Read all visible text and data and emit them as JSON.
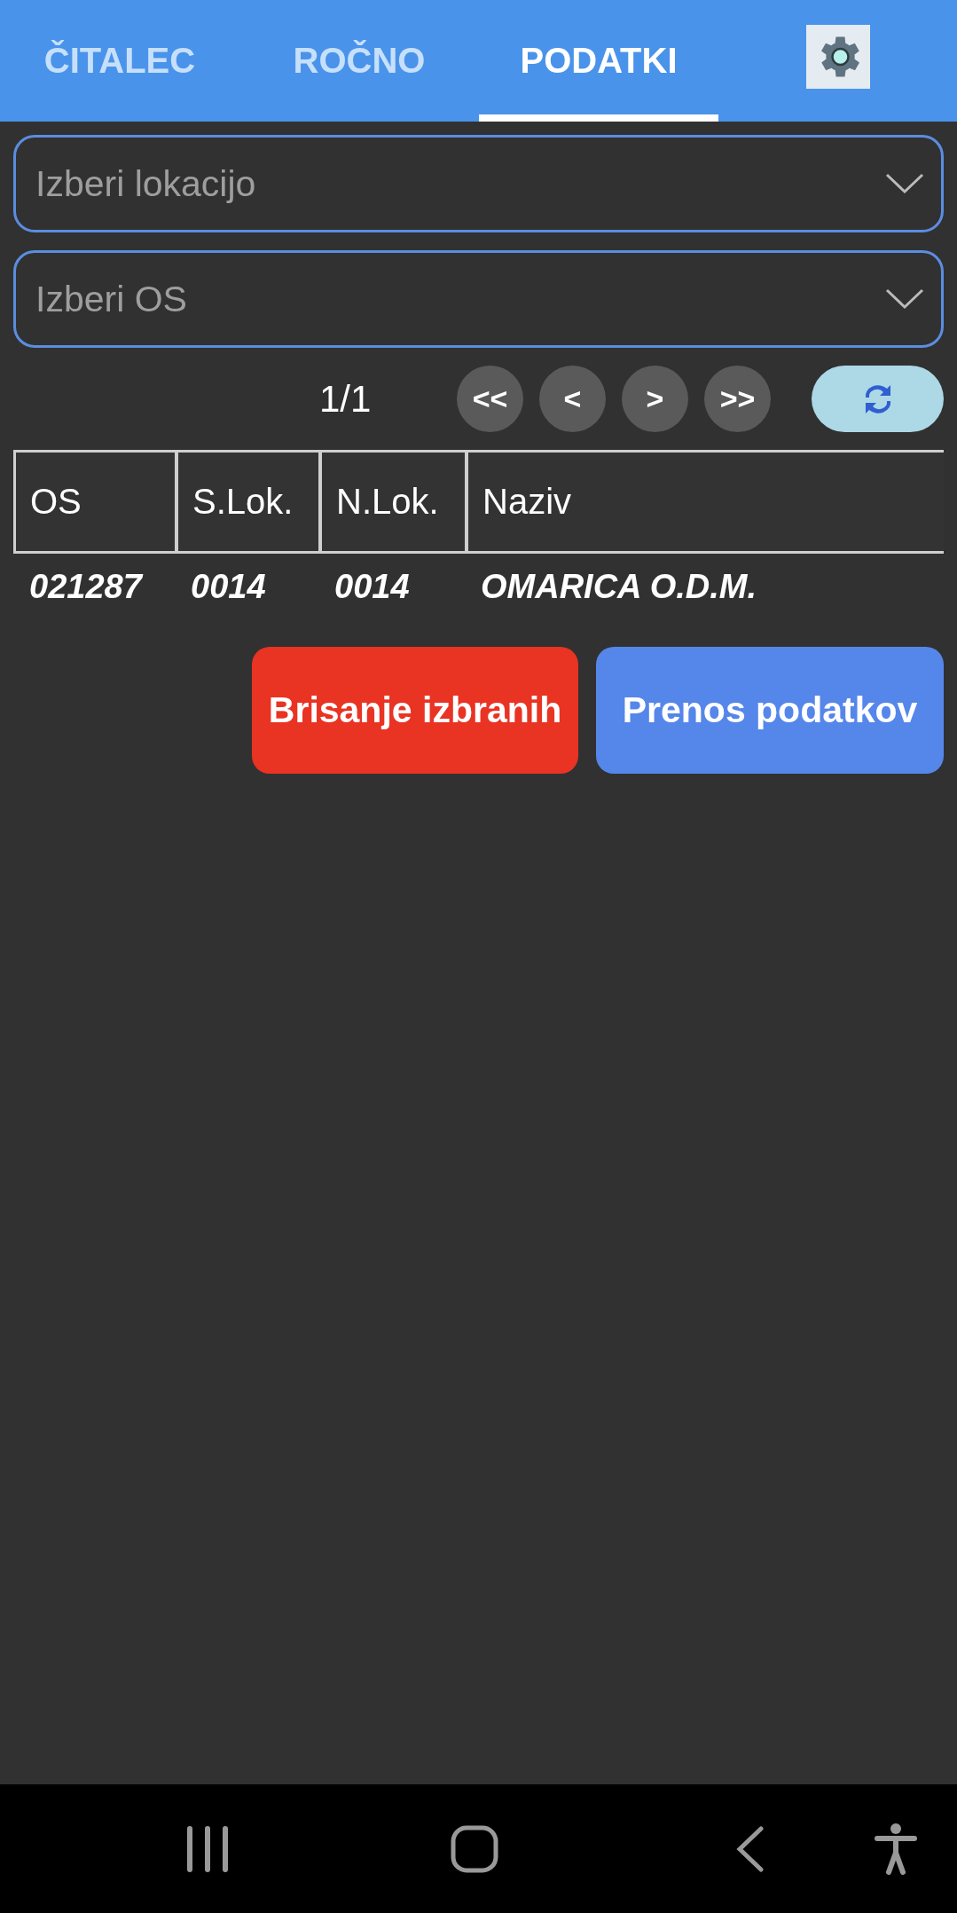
{
  "tabs": [
    {
      "label": "ČITALEC",
      "selected": false
    },
    {
      "label": "ROČNO",
      "selected": false
    },
    {
      "label": "PODATKI",
      "selected": true
    }
  ],
  "dropdowns": [
    {
      "placeholder": "Izberi lokacijo"
    },
    {
      "placeholder": "Izberi OS"
    }
  ],
  "pager": {
    "page": "1/1",
    "buttons": [
      "<<",
      "<",
      ">",
      ">>"
    ]
  },
  "table": {
    "columns": [
      "OS",
      "S.Lok.",
      "N.Lok.",
      "Naziv"
    ],
    "rows": [
      [
        "021287",
        "0014",
        "0014",
        "OMARICA O.D.M."
      ]
    ]
  },
  "actions": [
    {
      "label": "Brisanje izbranih",
      "kind": "danger"
    },
    {
      "label": "Prenos podatkov",
      "kind": "primary"
    }
  ]
}
